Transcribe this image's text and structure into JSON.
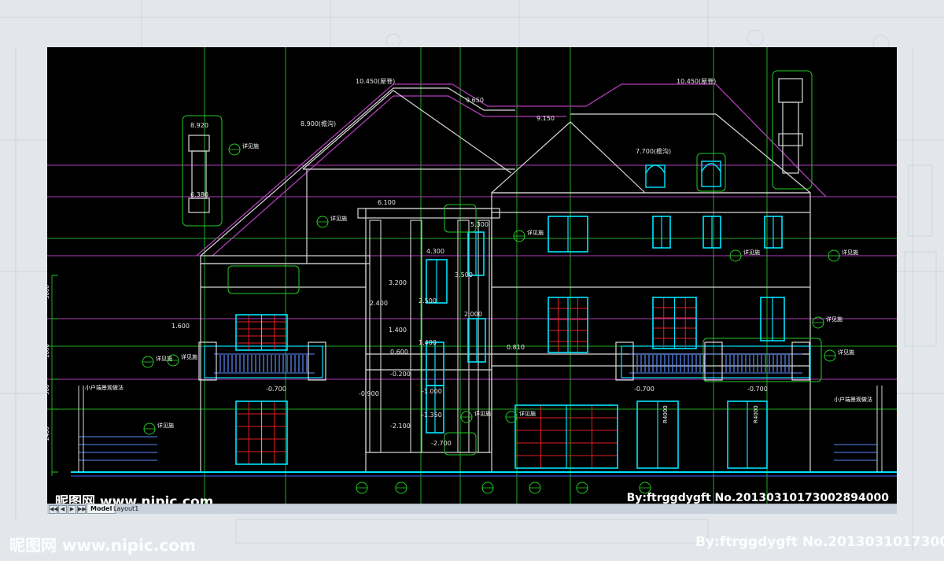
{
  "watermark": {
    "left": "昵图网 www.nipic.com",
    "right": "By:ftrggdygft  No.20130310173002894000",
    "big_left": "昵图网 www.nipic.com",
    "big_right": "By:ftrggdygft  No.2013031017300"
  },
  "tabs": {
    "items": [
      {
        "label": "Model",
        "active": true
      },
      {
        "label": "Layout1",
        "active": false
      }
    ],
    "nav_buttons": [
      "◀◀",
      "◀",
      "▶",
      "▶▶"
    ]
  },
  "drawing": {
    "elevations": {
      "roof_left": "10.450(屋脊)",
      "roof_right": "10.450(屋脊)",
      "ridge_mid": "9.650",
      "ridge_mid2": "9.150",
      "eave_left": "8.900(檐沟)",
      "chimney_top": "8.920",
      "chimney_mid": "6.380",
      "dormer": "7.700(檐沟)",
      "level_6100": "6.100",
      "level_5300": "5.300",
      "level_4300": "4.300",
      "level_3500": "3.500",
      "level_3200": "3.200",
      "level_2500": "2.500",
      "level_2400": "2.400",
      "level_2000": "2.000",
      "level_1600": "1.600",
      "level_1400a": "1.400",
      "level_1400b": "1.400",
      "level_0810": "0.810",
      "level_0600": "0.600",
      "level_m0200": "-0.200",
      "level_m0700a": "-0.700",
      "level_m0700b": "-0.700",
      "level_m0700c": "-0.700",
      "level_m0900": "-0.900",
      "level_m1000": "-1.000",
      "level_m1350": "-1.350",
      "level_m2100": "-2.100",
      "level_m2700": "-2.700"
    },
    "notes": {
      "detail": "详见施",
      "detail_count": 12,
      "landscape_left": "小户端景观做法",
      "landscape_right": "小户端景观做法",
      "arch_r1": "R4000",
      "arch_r2": "R4000"
    },
    "dims_left": [
      "3000",
      "1600",
      "900",
      "2400"
    ]
  },
  "colors": {
    "background": "#000000",
    "window": "#00e5ff",
    "line_green": "#22cc22",
    "line_magenta": "#b03cb8",
    "line_white": "#d8d8d8",
    "grid_red": "#e02020",
    "chrome": "#c9d2dc"
  }
}
